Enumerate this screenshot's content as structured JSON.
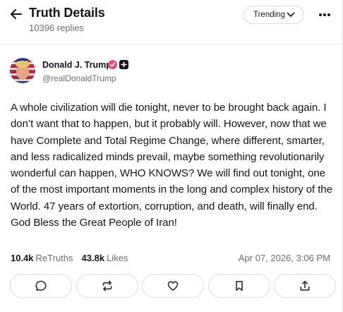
{
  "header": {
    "title": "Truth Details",
    "replies": "10396 replies",
    "sort_value": "Trending"
  },
  "icons": {
    "back": "arrow-left-icon",
    "sort": "chevron-down-icon",
    "more": "more-horizontal-icon",
    "verified": "verified-badge-icon",
    "plus": "plus-badge-icon",
    "reply": "comment-icon",
    "retruth": "repost-icon",
    "like": "heart-icon",
    "bookmark": "bookmark-icon",
    "share": "share-icon"
  },
  "author": {
    "name": "Donald J. Trump",
    "handle": "@realDonaldTrump"
  },
  "post": {
    "text": "A whole civilization will die tonight, never to be brought back again. I don’t want that to happen, but it probably will. However, now that we have Complete and Total Regime Change, where different, smarter, and less radicalized minds prevail, maybe something revolutionarily wonderful can happen, WHO KNOWS? We will find out tonight, one of the most important moments in the long and complex history of the World. 47 years of extortion, corruption, and death, will finally end. God Bless the Great People of Iran!"
  },
  "stats": {
    "retruths_count": "10.4k",
    "retruths_label": "ReTruths",
    "likes_count": "43.8k",
    "likes_label": "Likes",
    "timestamp": "Apr 07, 2026, 3:06 PM"
  },
  "colors": {
    "accent": "#e84e7a",
    "text": "#14141a",
    "muted": "#6b6b76",
    "border": "#dcdce2"
  }
}
